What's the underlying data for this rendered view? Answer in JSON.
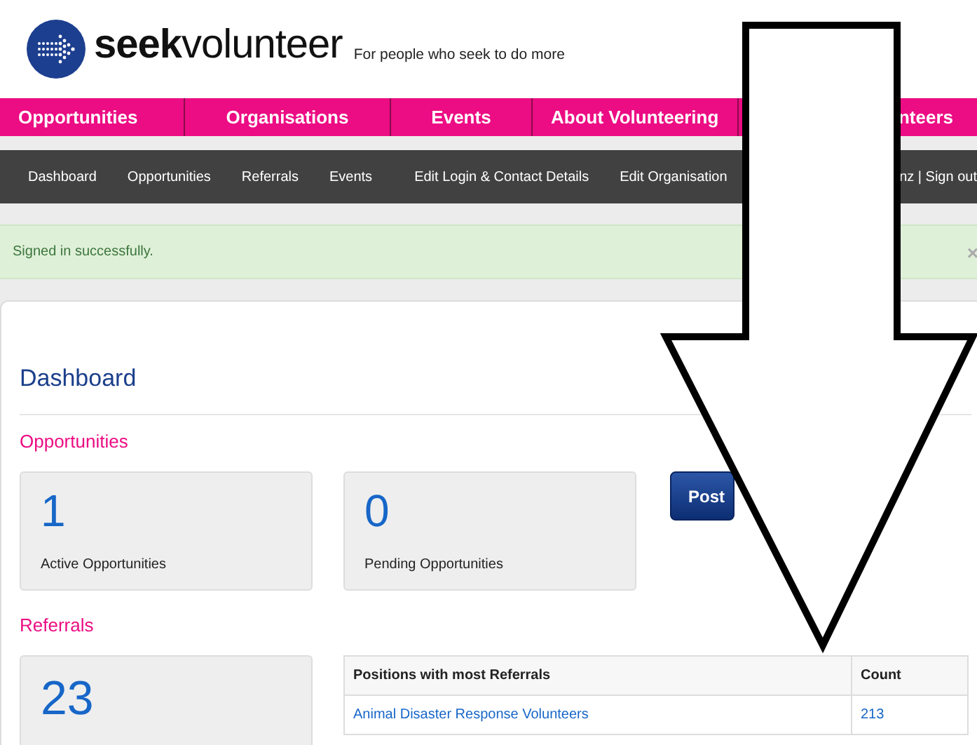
{
  "header": {
    "logo": "**seek**volunteer",
    "tagline": "For people who seek to do more"
  },
  "main_nav": [
    {
      "label": "Opportunities"
    },
    {
      "label": "Organisations"
    },
    {
      "label": "Events"
    },
    {
      "label": "About Volunteering"
    },
    {
      "label": "nteers"
    }
  ],
  "sub_nav": [
    {
      "label": "Dashboard"
    },
    {
      "label": "Opportunities"
    },
    {
      "label": "Referrals"
    },
    {
      "label": "Events"
    },
    {
      "label": "Edit Login & Contact Details"
    },
    {
      "label": "Edit Organisation"
    },
    {
      "label": "nz | Sign out"
    }
  ],
  "alert": {
    "message": "Signed in successfully.",
    "close": "×"
  },
  "dashboard": {
    "title": "Dashboard",
    "opportunities": {
      "heading": "Opportunities",
      "stats": [
        {
          "value": "1",
          "label": "Active Opportunities"
        },
        {
          "value": "0",
          "label": "Pending Opportunities"
        }
      ],
      "button": "Post"
    },
    "referrals": {
      "heading": "Referrals",
      "stats": [
        {
          "value": "23"
        }
      ],
      "table": {
        "columns": [
          "Positions with most Referrals",
          "Count"
        ],
        "rows": [
          [
            "Animal Disaster Response Volunteers",
            "213"
          ]
        ]
      }
    }
  }
}
